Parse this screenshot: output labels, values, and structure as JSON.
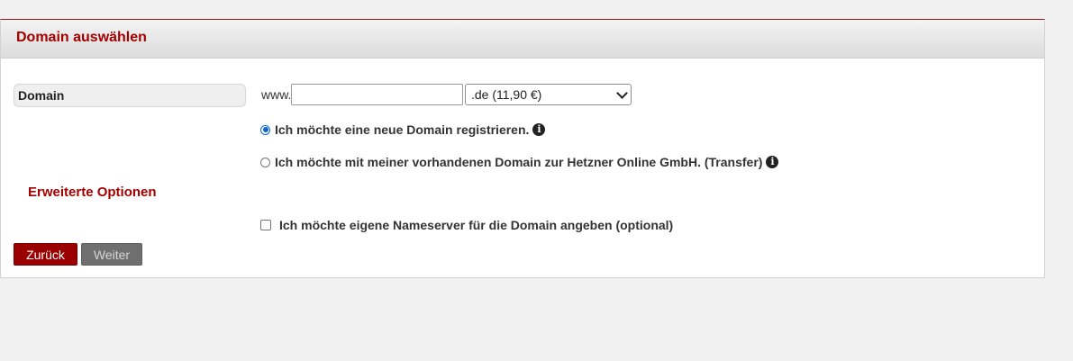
{
  "header": {
    "title": "Domain auswählen"
  },
  "domain": {
    "label": "Domain",
    "prefix": "www.",
    "input_value": "",
    "tld_selected": ".de (11,90 €)"
  },
  "options": {
    "register_label": "Ich möchte eine neue Domain registrieren.",
    "transfer_label": "Ich möchte mit meiner vorhandenen Domain zur Hetzner Online GmbH. (Transfer)",
    "selected": "register"
  },
  "advanced": {
    "title": "Erweiterte Optionen",
    "nameserver_label": "Ich möchte eigene Nameserver für die Domain angeben (optional)",
    "nameserver_checked": false
  },
  "buttons": {
    "back_label": "Zurück",
    "next_label": "Weiter"
  },
  "colors": {
    "accent": "#a30000",
    "button_primary": "#9a0000",
    "button_disabled": "#6f6f6f",
    "radio_selected": "#0b63ce"
  },
  "icons": {
    "info": "info-icon"
  }
}
